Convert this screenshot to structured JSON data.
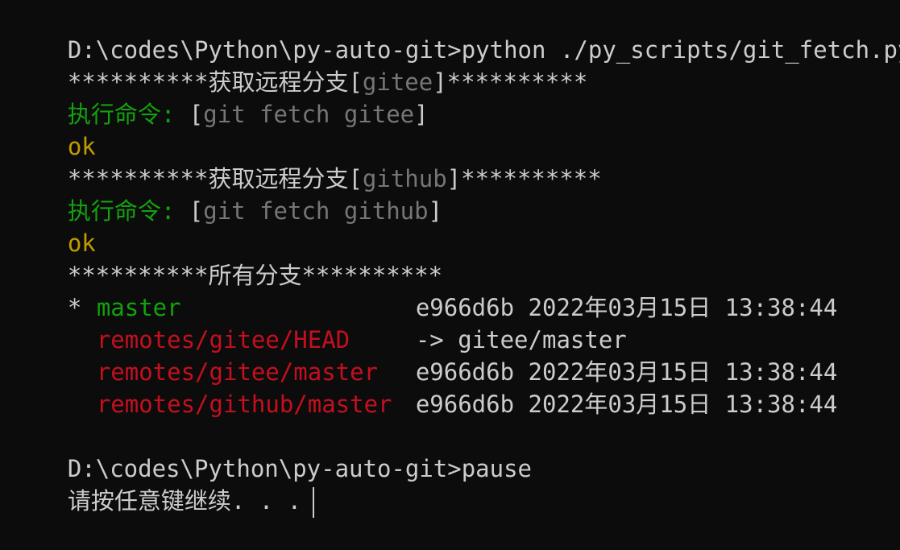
{
  "prompt_path": "D:\\codes\\Python\\py-auto-git>",
  "command": "python ./py_scripts/git_fetch.py",
  "colors": {
    "background": "#0c0c0c",
    "text": "#cccccc",
    "dim": "#767676",
    "green": "#13a10e",
    "yellow": "#c19c00",
    "red": "#c50f1f"
  },
  "fetch_blocks": [
    {
      "header_prefix": "**********获取远程分支[",
      "remote": "gitee",
      "header_suffix": "]**********",
      "exec_label": "执行命令:",
      "open_bracket": " [",
      "exec_cmd": "git fetch gitee",
      "close_bracket": "]",
      "result": "ok"
    },
    {
      "header_prefix": "**********获取远程分支[",
      "remote": "github",
      "header_suffix": "]**********",
      "exec_label": "执行命令:",
      "open_bracket": " [",
      "exec_cmd": "git fetch github",
      "close_bracket": "]",
      "result": "ok"
    }
  ],
  "branches_header": "**********所有分支**********",
  "branches": [
    {
      "marker": "* ",
      "name": "master",
      "info": "e966d6b 2022年03月15日 13:38:44"
    },
    {
      "marker": "  ",
      "name": "remotes/gitee/HEAD",
      "info": "-> gitee/master"
    },
    {
      "marker": "  ",
      "name": "remotes/gitee/master",
      "info": "e966d6b 2022年03月15日 13:38:44"
    },
    {
      "marker": "  ",
      "name": "remotes/github/master",
      "info": "e966d6b 2022年03月15日 13:38:44"
    }
  ],
  "command2": "pause",
  "pause_message": "请按任意键继续. . ."
}
